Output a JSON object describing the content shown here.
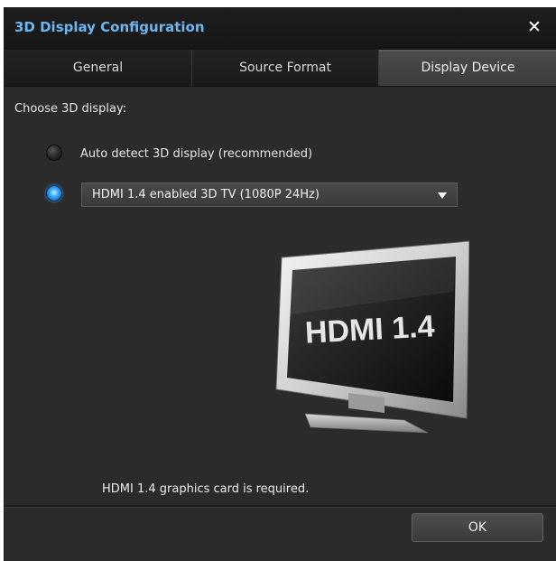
{
  "dialog": {
    "title": "3D Display Configuration",
    "close_glyph": "✕"
  },
  "tabs": [
    {
      "label": "General",
      "active": false
    },
    {
      "label": "Source Format",
      "active": false
    },
    {
      "label": "Display Device",
      "active": true
    }
  ],
  "content": {
    "choose_label": "Choose 3D display:",
    "option_auto": {
      "label": "Auto detect 3D display (recommended)",
      "selected": false
    },
    "option_manual": {
      "selected": true
    },
    "display_select": {
      "value": "HDMI 1.4 enabled 3D TV (1080P 24Hz)"
    },
    "illustration": {
      "screen_text": "HDMI 1.4",
      "icon": "tv-monitor-icon"
    },
    "note": "HDMI 1.4 graphics card is required."
  },
  "footer": {
    "ok_label": "OK"
  },
  "colors": {
    "title": "#6fb6f0",
    "background": "#2b2b2b",
    "accent_radio": "#3fb0ff"
  }
}
